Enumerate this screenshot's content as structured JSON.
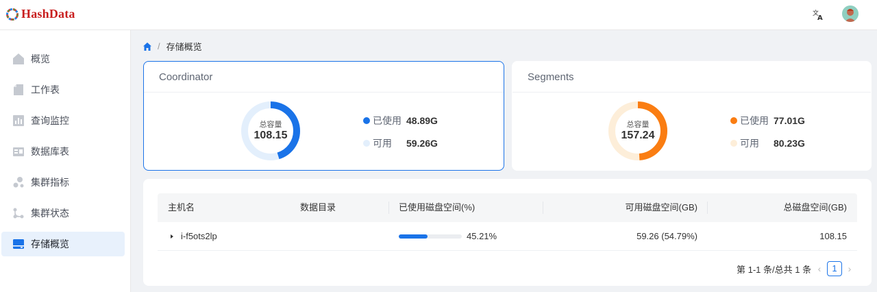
{
  "header": {
    "logo_text": "HashData",
    "translate_icon": "translate-icon",
    "avatar_icon": "user-avatar"
  },
  "sidebar": {
    "items": [
      {
        "label": "概览",
        "icon": "home-icon",
        "active": false
      },
      {
        "label": "工作表",
        "icon": "document-icon",
        "active": false
      },
      {
        "label": "查询监控",
        "icon": "bar-chart-icon",
        "active": false
      },
      {
        "label": "数据库表",
        "icon": "database-table-icon",
        "active": false
      },
      {
        "label": "集群指标",
        "icon": "cluster-metrics-icon",
        "active": false
      },
      {
        "label": "集群状态",
        "icon": "cluster-status-icon",
        "active": false
      },
      {
        "label": "存储概览",
        "icon": "storage-icon",
        "active": true
      }
    ]
  },
  "breadcrumb": {
    "home_icon": "home-icon",
    "separator": "/",
    "current": "存储概览"
  },
  "coordinator": {
    "title": "Coordinator",
    "total_label": "总容量",
    "total_value": "108.15",
    "used_label": "已使用",
    "used_value": "48.89G",
    "free_label": "可用",
    "free_value": "59.26G",
    "used_fraction": 0.452,
    "used_color": "#1a73e8",
    "free_color": "#e3effc"
  },
  "segments": {
    "title": "Segments",
    "total_label": "总容量",
    "total_value": "157.24",
    "used_label": "已使用",
    "used_value": "77.01G",
    "free_label": "可用",
    "free_value": "80.23G",
    "used_fraction": 0.49,
    "used_color": "#fa7d12",
    "free_color": "#fdeed9"
  },
  "table": {
    "columns": [
      "主机名",
      "数据目录",
      "已使用磁盘空间(%)",
      "可用磁盘空间(GB)",
      "总磁盘空间(GB)"
    ],
    "rows": [
      {
        "host": "i-f5ots2lp",
        "data_dir": "",
        "used_percent_text": "45.21%",
        "used_fraction": 0.4521,
        "free_gb": "59.26 (54.79%)",
        "total_gb": "108.15"
      }
    ]
  },
  "pagination": {
    "summary": "第 1-1 条/总共 1 条",
    "current_page": "1",
    "prev_icon": "chevron-left-icon",
    "next_icon": "chevron-right-icon"
  }
}
